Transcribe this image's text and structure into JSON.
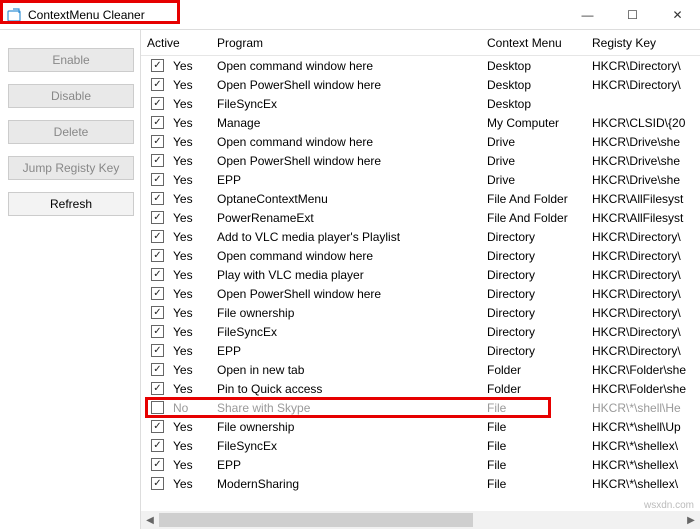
{
  "window": {
    "title": "ContextMenu Cleaner"
  },
  "sidebar": {
    "enable": "Enable",
    "disable": "Disable",
    "delete": "Delete",
    "jump": "Jump Registy Key",
    "refresh": "Refresh"
  },
  "columns": {
    "active": "Active",
    "program": "Program",
    "context": "Context Menu",
    "reg": "Registy Key"
  },
  "rows": [
    {
      "checked": true,
      "active": "Yes",
      "program": "Open command window here",
      "context": "Desktop",
      "reg": "HKCR\\Directory\\"
    },
    {
      "checked": true,
      "active": "Yes",
      "program": "Open PowerShell window here",
      "context": "Desktop",
      "reg": "HKCR\\Directory\\"
    },
    {
      "checked": true,
      "active": "Yes",
      "program": " FileSyncEx",
      "context": "Desktop",
      "reg": ""
    },
    {
      "checked": true,
      "active": "Yes",
      "program": "Manage",
      "context": "My Computer",
      "reg": "HKCR\\CLSID\\{20"
    },
    {
      "checked": true,
      "active": "Yes",
      "program": "Open command window here",
      "context": "Drive",
      "reg": "HKCR\\Drive\\she"
    },
    {
      "checked": true,
      "active": "Yes",
      "program": "Open PowerShell window here",
      "context": "Drive",
      "reg": "HKCR\\Drive\\she"
    },
    {
      "checked": true,
      "active": "Yes",
      "program": "EPP",
      "context": "Drive",
      "reg": "HKCR\\Drive\\she"
    },
    {
      "checked": true,
      "active": "Yes",
      "program": "OptaneContextMenu",
      "context": "File And Folder",
      "reg": "HKCR\\AllFilesyst"
    },
    {
      "checked": true,
      "active": "Yes",
      "program": "PowerRenameExt",
      "context": "File And Folder",
      "reg": "HKCR\\AllFilesyst"
    },
    {
      "checked": true,
      "active": "Yes",
      "program": "Add to VLC media player's Playlist",
      "context": "Directory",
      "reg": "HKCR\\Directory\\"
    },
    {
      "checked": true,
      "active": "Yes",
      "program": "Open command window here",
      "context": "Directory",
      "reg": "HKCR\\Directory\\"
    },
    {
      "checked": true,
      "active": "Yes",
      "program": "Play with VLC media player",
      "context": "Directory",
      "reg": "HKCR\\Directory\\"
    },
    {
      "checked": true,
      "active": "Yes",
      "program": "Open PowerShell window here",
      "context": "Directory",
      "reg": "HKCR\\Directory\\"
    },
    {
      "checked": true,
      "active": "Yes",
      "program": "File ownership",
      "context": "Directory",
      "reg": "HKCR\\Directory\\"
    },
    {
      "checked": true,
      "active": "Yes",
      "program": " FileSyncEx",
      "context": "Directory",
      "reg": "HKCR\\Directory\\"
    },
    {
      "checked": true,
      "active": "Yes",
      "program": "EPP",
      "context": "Directory",
      "reg": "HKCR\\Directory\\"
    },
    {
      "checked": true,
      "active": "Yes",
      "program": "Open in new tab",
      "context": "Folder",
      "reg": "HKCR\\Folder\\she"
    },
    {
      "checked": true,
      "active": "Yes",
      "program": "Pin to Quick access",
      "context": "Folder",
      "reg": "HKCR\\Folder\\she"
    },
    {
      "checked": false,
      "active": "No",
      "program": "Share with Skype",
      "context": "File",
      "reg": "HKCR\\*\\shell\\He",
      "highlight": true,
      "disabled": true
    },
    {
      "checked": true,
      "active": "Yes",
      "program": "File ownership",
      "context": "File",
      "reg": "HKCR\\*\\shell\\Up"
    },
    {
      "checked": true,
      "active": "Yes",
      "program": " FileSyncEx",
      "context": "File",
      "reg": "HKCR\\*\\shellex\\"
    },
    {
      "checked": true,
      "active": "Yes",
      "program": "EPP",
      "context": "File",
      "reg": "HKCR\\*\\shellex\\"
    },
    {
      "checked": true,
      "active": "Yes",
      "program": "ModernSharing",
      "context": "File",
      "reg": "HKCR\\*\\shellex\\"
    }
  ],
  "watermark": "wsxdn.com"
}
